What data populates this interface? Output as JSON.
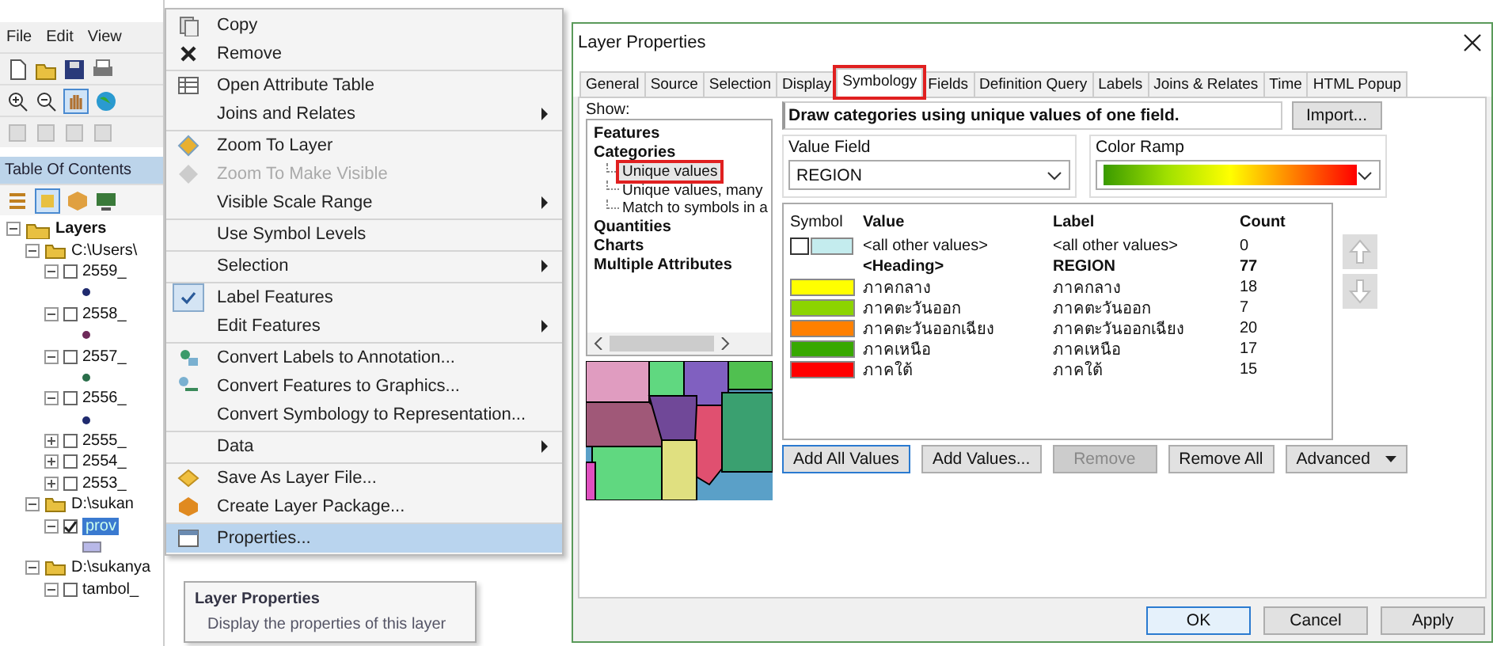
{
  "arcmap": {
    "menu_bar": [
      "File",
      "Edit",
      "View"
    ],
    "toc_title": "Table Of Contents",
    "toc_tree": [
      {
        "label": "Layers",
        "expanded": true,
        "children": [
          {
            "label": "C:\\Users\\",
            "expanded": true,
            "folder": true,
            "children": [
              {
                "label": "2559_",
                "expanded": true,
                "checked": false,
                "color": "#1f2a6e"
              },
              {
                "label": "2558_",
                "expanded": true,
                "checked": false,
                "color": "#6e2a5a"
              },
              {
                "label": "2557_",
                "expanded": true,
                "checked": false,
                "color": "#2a6e4a"
              },
              {
                "label": "2556_",
                "expanded": true,
                "checked": false,
                "color": "#1f2a6e"
              },
              {
                "label": "2555_",
                "expanded": false,
                "checked": false
              },
              {
                "label": "2554_",
                "expanded": false,
                "checked": false
              },
              {
                "label": "2553_",
                "expanded": false,
                "checked": false
              }
            ]
          },
          {
            "label": "D:\\sukan",
            "expanded": true,
            "folder": true,
            "children": [
              {
                "label": "prov",
                "expanded": true,
                "checked": true,
                "selected": true,
                "color": "#b8b8e8"
              }
            ]
          },
          {
            "label": "D:\\sukanya",
            "expanded": true,
            "folder": true,
            "children": [
              {
                "label": "tambol_",
                "expanded": true,
                "checked": false
              }
            ]
          }
        ]
      }
    ]
  },
  "context_menu": {
    "items": [
      {
        "label": "Copy",
        "submenu": false,
        "disabled": false,
        "checked": false,
        "selected": false,
        "separator_after": false
      },
      {
        "label": "Remove",
        "submenu": false,
        "disabled": false,
        "checked": false,
        "selected": false,
        "separator_after": true
      },
      {
        "label": "Open Attribute Table",
        "submenu": false,
        "disabled": false,
        "checked": false,
        "selected": false,
        "separator_after": false
      },
      {
        "label": "Joins and Relates",
        "submenu": true,
        "disabled": false,
        "checked": false,
        "selected": false,
        "separator_after": true
      },
      {
        "label": "Zoom To Layer",
        "submenu": false,
        "disabled": false,
        "checked": false,
        "selected": false,
        "separator_after": false
      },
      {
        "label": "Zoom To Make Visible",
        "submenu": false,
        "disabled": true,
        "checked": false,
        "selected": false,
        "separator_after": false
      },
      {
        "label": "Visible Scale Range",
        "submenu": true,
        "disabled": false,
        "checked": false,
        "selected": false,
        "separator_after": true
      },
      {
        "label": "Use Symbol Levels",
        "submenu": false,
        "disabled": false,
        "checked": false,
        "selected": false,
        "separator_after": true
      },
      {
        "label": "Selection",
        "submenu": true,
        "disabled": false,
        "checked": false,
        "selected": false,
        "separator_after": true
      },
      {
        "label": "Label Features",
        "submenu": false,
        "disabled": false,
        "checked": true,
        "selected": false,
        "separator_after": false
      },
      {
        "label": "Edit Features",
        "submenu": true,
        "disabled": false,
        "checked": false,
        "selected": false,
        "separator_after": true
      },
      {
        "label": "Convert Labels to Annotation...",
        "submenu": false,
        "disabled": false,
        "checked": false,
        "selected": false,
        "separator_after": false
      },
      {
        "label": "Convert Features to Graphics...",
        "submenu": false,
        "disabled": false,
        "checked": false,
        "selected": false,
        "separator_after": false
      },
      {
        "label": "Convert Symbology to Representation...",
        "submenu": false,
        "disabled": false,
        "checked": false,
        "selected": false,
        "separator_after": true
      },
      {
        "label": "Data",
        "submenu": true,
        "disabled": false,
        "checked": false,
        "selected": false,
        "separator_after": true
      },
      {
        "label": "Save As Layer File...",
        "submenu": false,
        "disabled": false,
        "checked": false,
        "selected": false,
        "separator_after": false
      },
      {
        "label": "Create Layer Package...",
        "submenu": false,
        "disabled": false,
        "checked": false,
        "selected": false,
        "separator_after": true
      },
      {
        "label": "Properties...",
        "submenu": false,
        "disabled": false,
        "checked": false,
        "selected": true,
        "separator_after": false
      }
    ]
  },
  "tooltip": {
    "title": "Layer Properties",
    "text": "Display the properties of this layer"
  },
  "dialog": {
    "title": "Layer Properties",
    "tabs": [
      {
        "label": "General",
        "selected": false,
        "highlighted": false
      },
      {
        "label": "Source",
        "selected": false,
        "highlighted": false
      },
      {
        "label": "Selection",
        "selected": false,
        "highlighted": false
      },
      {
        "label": "Display",
        "selected": false,
        "highlighted": false
      },
      {
        "label": "Symbology",
        "selected": true,
        "highlighted": true
      },
      {
        "label": "Fields",
        "selected": false,
        "highlighted": false
      },
      {
        "label": "Definition Query",
        "selected": false,
        "highlighted": false
      },
      {
        "label": "Labels",
        "selected": false,
        "highlighted": false
      },
      {
        "label": "Joins & Relates",
        "selected": false,
        "highlighted": false
      },
      {
        "label": "Time",
        "selected": false,
        "highlighted": false
      },
      {
        "label": "HTML Popup",
        "selected": false,
        "highlighted": false
      }
    ],
    "show_label": "Show:",
    "show_tree": [
      {
        "label": "Features"
      },
      {
        "label": "Categories",
        "children": [
          {
            "label": "Unique values",
            "selected": true,
            "highlighted": true
          },
          {
            "label": "Unique values, many",
            "selected": false,
            "highlighted": false
          },
          {
            "label": "Match to symbols in a",
            "selected": false,
            "highlighted": false
          }
        ]
      },
      {
        "label": "Quantities"
      },
      {
        "label": "Charts"
      },
      {
        "label": "Multiple Attributes"
      }
    ],
    "description": "Draw categories using unique values of one field.",
    "import_button": "Import...",
    "value_field": {
      "legend": "Value Field",
      "value": "REGION"
    },
    "color_ramp": {
      "legend": "Color Ramp"
    },
    "table": {
      "columns": [
        "Symbol",
        "Value",
        "Label",
        "Count"
      ],
      "rows": [
        {
          "kind": "other",
          "checked": false,
          "color": "#c4ecee",
          "value": "<all other values>",
          "label": "<all other values>",
          "count": "0"
        },
        {
          "kind": "heading",
          "value": "<Heading>",
          "label": "REGION",
          "count": "77"
        },
        {
          "kind": "class",
          "color": "#ffff00",
          "value": "ภาคกลาง",
          "label": "ภาคกลาง",
          "count": "18"
        },
        {
          "kind": "class",
          "color": "#8cd400",
          "value": "ภาคตะวันออก",
          "label": "ภาคตะวันออก",
          "count": "7"
        },
        {
          "kind": "class",
          "color": "#ff8000",
          "value": "ภาคตะวันออกเฉียง",
          "label": "ภาคตะวันออกเฉียง",
          "count": "20"
        },
        {
          "kind": "class",
          "color": "#38a800",
          "value": "ภาคเหนือ",
          "label": "ภาคเหนือ",
          "count": "17"
        },
        {
          "kind": "class",
          "color": "#ff0000",
          "value": "ภาคใต้",
          "label": "ภาคใต้",
          "count": "15"
        }
      ]
    },
    "action_buttons": [
      {
        "label": "Add All Values",
        "disabled": false,
        "focused": true,
        "dropdown": false
      },
      {
        "label": "Add Values...",
        "disabled": false,
        "focused": false,
        "dropdown": false
      },
      {
        "label": "Remove",
        "disabled": true,
        "focused": false,
        "dropdown": false
      },
      {
        "label": "Remove All",
        "disabled": false,
        "focused": false,
        "dropdown": false
      },
      {
        "label": "Advanced",
        "disabled": false,
        "focused": false,
        "dropdown": true
      }
    ],
    "footer_buttons": [
      {
        "label": "OK",
        "focused": true
      },
      {
        "label": "Cancel",
        "focused": false
      },
      {
        "label": "Apply",
        "focused": false
      }
    ]
  }
}
